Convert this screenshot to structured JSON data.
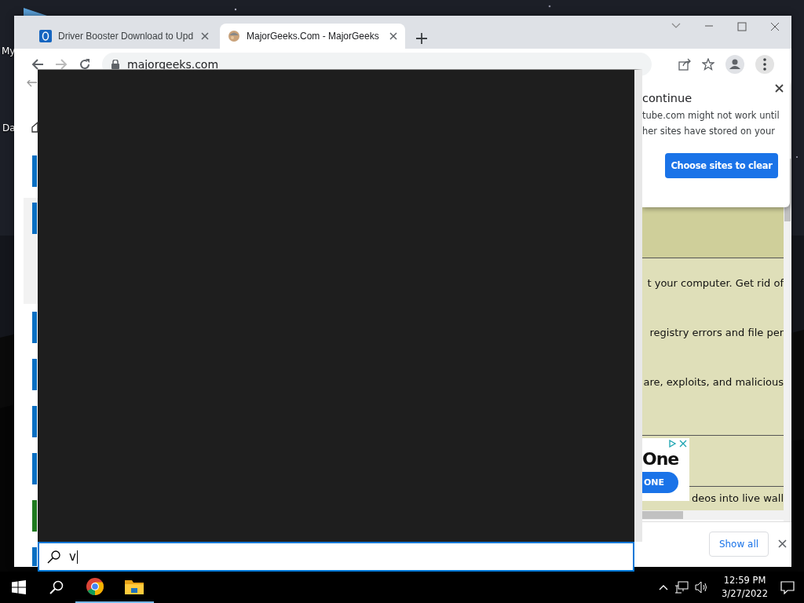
{
  "desktop": {
    "icons": [
      {
        "label": "My"
      },
      {
        "label": "Da"
      }
    ]
  },
  "browser": {
    "tabs": [
      {
        "title": "Driver Booster Download to Upd",
        "selected": false
      },
      {
        "title": "MajorGeeks.Com - MajorGeeks",
        "selected": true
      }
    ],
    "address": "majorgeeks.com"
  },
  "settings_page": {
    "items": [
      {
        "color": "#0a6fc2"
      },
      {
        "color": "#0a6fc2"
      },
      {
        "color": "#0a6fc2"
      },
      {
        "color": "#0a6fc2"
      },
      {
        "color": "#0a6fc2"
      },
      {
        "color": "#0a6fc2"
      },
      {
        "color": "#1f7a1f"
      },
      {
        "color": "#0a6fc2"
      }
    ]
  },
  "clear_popup": {
    "title": "continue",
    "lines": [
      "tube.com might not work until",
      "her sites have stored on your"
    ],
    "button": "Choose sites to clear"
  },
  "page": {
    "lines": [
      "t your computer. Get rid of",
      "registry errors and file per",
      "are, exploits, and malicious",
      "deos into live wall"
    ],
    "ad": {
      "headline": "One",
      "button": "ONE"
    }
  },
  "downloads_bar": {
    "button": "Show all"
  },
  "start_search": {
    "value": "v"
  },
  "taskbar": {
    "apps": [
      {
        "kind": "chrome",
        "running": true
      },
      {
        "kind": "explorer",
        "running": true
      }
    ],
    "time": "12:59 PM",
    "date": "3/27/2022"
  }
}
